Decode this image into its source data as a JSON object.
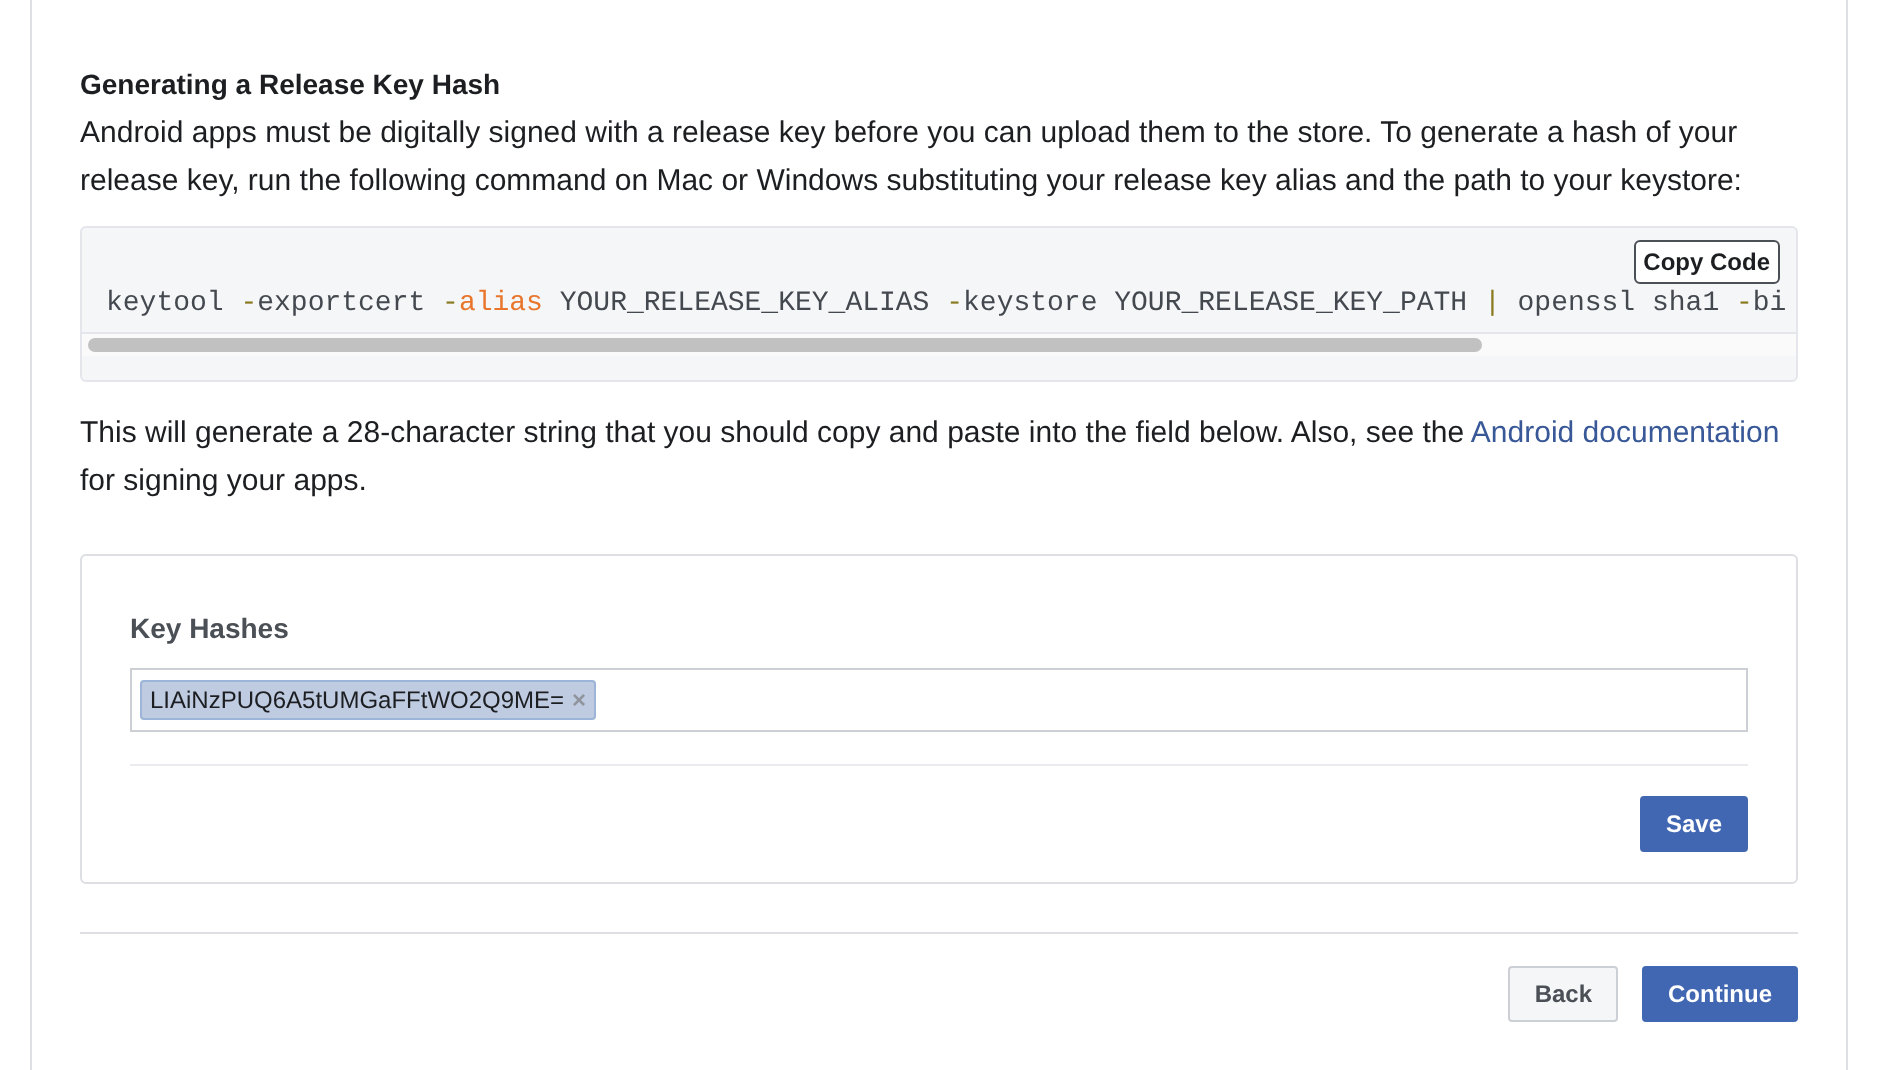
{
  "section": {
    "heading": "Generating a Release Key Hash",
    "intro": "Android apps must be digitally signed with a release key before you can upload them to the store. To generate a hash of your release key, run the following command on Mac or Windows substituting your release key alias and the path to your keystore:",
    "code": {
      "copy_button": "Copy Code",
      "tokens": [
        {
          "text": "keytool ",
          "kind": "plain"
        },
        {
          "text": "-",
          "kind": "operator"
        },
        {
          "text": "exportcert ",
          "kind": "plain"
        },
        {
          "text": "-",
          "kind": "operator"
        },
        {
          "text": "alias",
          "kind": "keyword"
        },
        {
          "text": " YOUR_RELEASE_KEY_ALIAS ",
          "kind": "plain"
        },
        {
          "text": "-",
          "kind": "operator"
        },
        {
          "text": "keystore YOUR_RELEASE_KEY_PATH ",
          "kind": "plain"
        },
        {
          "text": "|",
          "kind": "operator"
        },
        {
          "text": " openssl sha1 ",
          "kind": "plain"
        },
        {
          "text": "-",
          "kind": "operator"
        },
        {
          "text": "bi",
          "kind": "plain"
        }
      ]
    },
    "note": {
      "before": "This will generate a 28-character string that you should copy and paste into the field below. Also, see the",
      "link": "Android documentation",
      "after": "for signing your apps."
    }
  },
  "key_hashes": {
    "label": "Key Hashes",
    "tokens": [
      {
        "text": "LIAiNzPUQ6A5tUMGaFFtWO2Q9ME=",
        "remove": "×"
      }
    ],
    "save_button": "Save"
  },
  "buttons": [
    {
      "label": "Back",
      "kind": "secondary"
    },
    {
      "label": "Continue",
      "kind": "primary"
    }
  ]
}
